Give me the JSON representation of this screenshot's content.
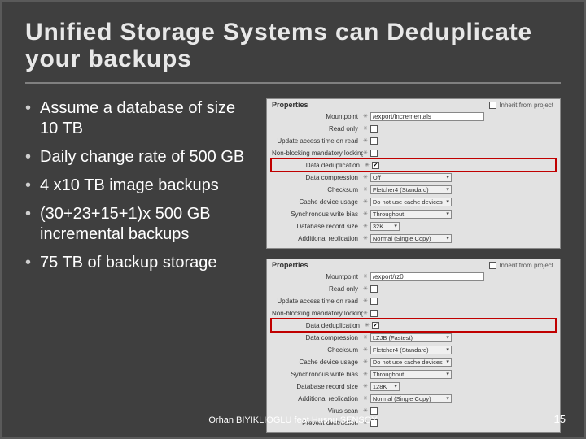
{
  "title": "Unified Storage Systems can Deduplicate your backups",
  "bullets": [
    "Assume a database of size 10 TB",
    "Daily change rate of 500 GB",
    "4 x10 TB image backups",
    "(30+23+15+1)x 500 GB incremental backups",
    "75 TB of backup storage"
  ],
  "panels": {
    "top": {
      "title": "Properties",
      "inherit_label": "Inherit from project",
      "highlight_index": 4,
      "rows": [
        {
          "label": "Mountpoint",
          "type": "input",
          "value": "/export/incrementals"
        },
        {
          "label": "Read only",
          "type": "checkbox",
          "checked": false
        },
        {
          "label": "Update access time on read",
          "type": "checkbox",
          "checked": false
        },
        {
          "label": "Non-blocking mandatory locking",
          "type": "checkbox",
          "checked": false
        },
        {
          "label": "Data deduplication",
          "type": "checkbox",
          "checked": true
        },
        {
          "label": "Data compression",
          "type": "select",
          "value": "Off"
        },
        {
          "label": "Checksum",
          "type": "select",
          "value": "Fletcher4 (Standard)"
        },
        {
          "label": "Cache device usage",
          "type": "select",
          "value": "Do not use cache devices"
        },
        {
          "label": "Synchronous write bias",
          "type": "select",
          "value": "Throughput"
        },
        {
          "label": "Database record size",
          "type": "select",
          "value": "32K",
          "small": true
        },
        {
          "label": "Additional replication",
          "type": "select",
          "value": "Normal (Single Copy)"
        }
      ]
    },
    "bottom": {
      "title": "Properties",
      "inherit_label": "Inherit from project",
      "highlight_index": 4,
      "rows": [
        {
          "label": "Mountpoint",
          "type": "input",
          "value": "/export/rz0"
        },
        {
          "label": "Read only",
          "type": "checkbox",
          "checked": false
        },
        {
          "label": "Update access time on read",
          "type": "checkbox",
          "checked": false
        },
        {
          "label": "Non-blocking mandatory locking",
          "type": "checkbox",
          "checked": false
        },
        {
          "label": "Data deduplication",
          "type": "checkbox",
          "checked": true
        },
        {
          "label": "Data compression",
          "type": "select",
          "value": "LZJB (Fastest)"
        },
        {
          "label": "Checksum",
          "type": "select",
          "value": "Fletcher4 (Standard)"
        },
        {
          "label": "Cache device usage",
          "type": "select",
          "value": "Do not use cache devices"
        },
        {
          "label": "Synchronous write bias",
          "type": "select",
          "value": "Throughput"
        },
        {
          "label": "Database record size",
          "type": "select",
          "value": "128K",
          "small": true
        },
        {
          "label": "Additional replication",
          "type": "select",
          "value": "Normal (Single Copy)"
        },
        {
          "label": "Virus scan",
          "type": "checkbox",
          "checked": false
        },
        {
          "label": "Prevent destruction",
          "type": "checkbox",
          "checked": false
        }
      ]
    }
  },
  "footer": "Orhan BIYIKLIOGLU feat Husnu SENSOY",
  "page_number": "15"
}
